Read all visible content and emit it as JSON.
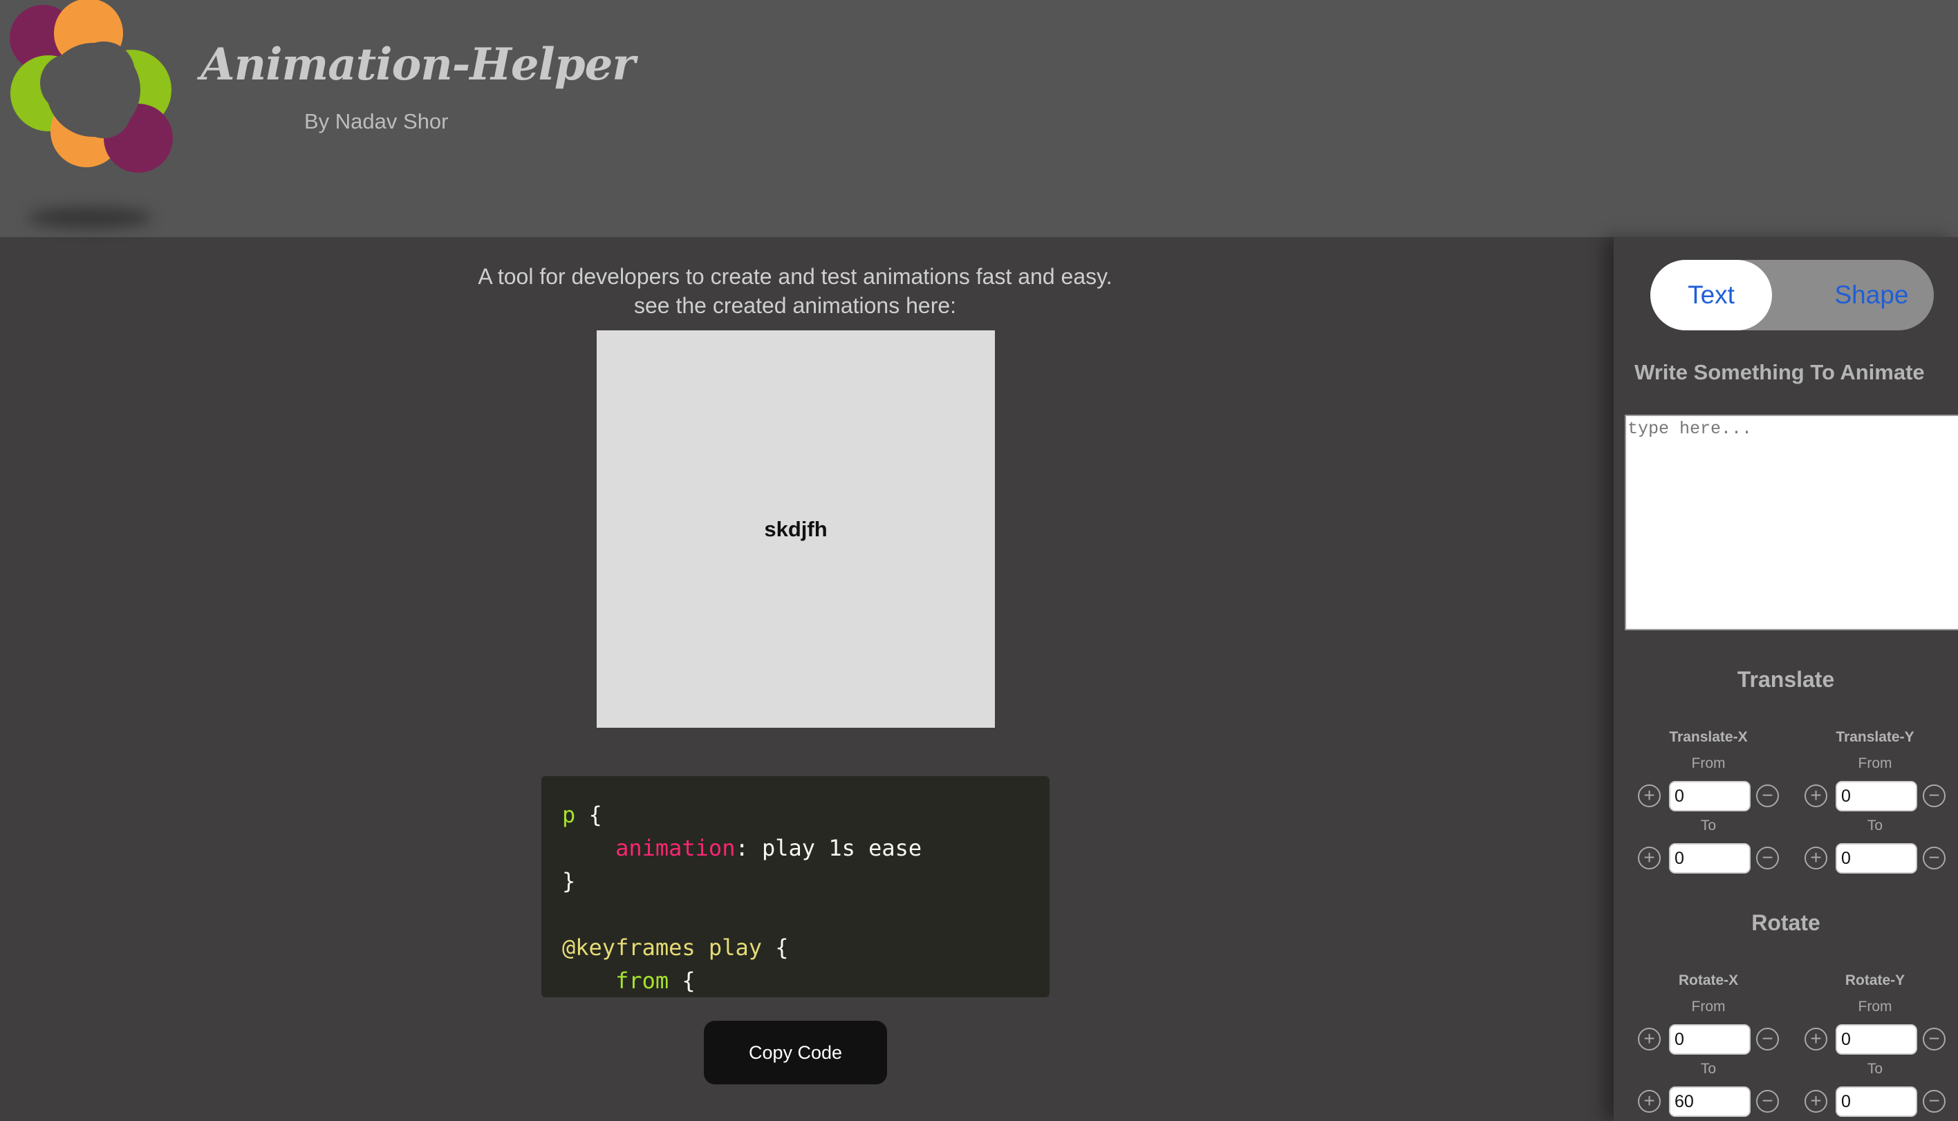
{
  "header": {
    "title": "Animation-Helper",
    "byline": "By Nadav Shor",
    "logo_colors": [
      "#7b2357",
      "#f59a3c",
      "#8fc21a"
    ]
  },
  "main": {
    "intro_line1": "A tool for developers to create and test animations fast and easy.",
    "intro_line2": "see the created animations here:",
    "preview_text": "skdjfh",
    "code": {
      "l1_selector": "p",
      "l1_brace": " {",
      "l2_property": "animation",
      "l2_value": ": play 1s ease",
      "l3": "}",
      "l5_at": "@keyframes play",
      "l5_brace": " {",
      "l6_from": "from",
      "l6_brace": " {"
    },
    "copy_label": "Copy Code"
  },
  "panel": {
    "toggle": {
      "text_label": "Text",
      "shape_label": "Shape",
      "selected": "Text"
    },
    "write_label": "Write Something To Animate",
    "input_placeholder": "type here...",
    "translate": {
      "title": "Translate",
      "x_label": "Translate-X",
      "y_label": "Translate-Y",
      "x_from": "0",
      "x_to": "0",
      "y_from": "0",
      "y_to": "0"
    },
    "rotate": {
      "title": "Rotate",
      "x_label": "Rotate-X",
      "y_label": "Rotate-Y",
      "x_from": "0",
      "x_to": "60",
      "y_from": "0",
      "y_to": "0"
    },
    "from_label": "From",
    "to_label": "To",
    "plus_glyph": "+",
    "minus_glyph": "−",
    "accent_color": "#1f5ed8"
  }
}
